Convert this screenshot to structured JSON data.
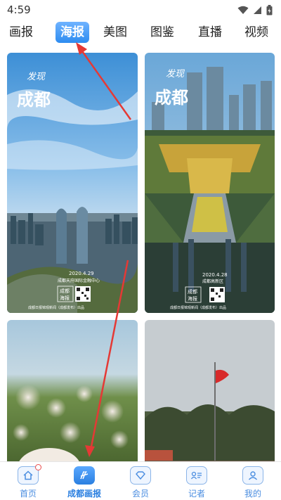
{
  "status_bar": {
    "time": "4:59",
    "icons": [
      "wifi-icon",
      "signal-icon",
      "battery-icon"
    ]
  },
  "tabs": [
    {
      "label": "画报",
      "active": false
    },
    {
      "label": "海报",
      "active": true
    },
    {
      "label": "美图",
      "active": false
    },
    {
      "label": "图鉴",
      "active": false
    },
    {
      "label": "直播",
      "active": false
    },
    {
      "label": "视频",
      "active": false
    }
  ],
  "posters": [
    {
      "title_small": "发现",
      "title_big": "成都",
      "date": "2020.4.29",
      "caption": "成都天府国际金融中心",
      "logo_line1": "成都",
      "logo_line2": "海报",
      "credit": "成都日报锦观新闻（成都发布）出品"
    },
    {
      "title_small": "发现",
      "title_big": "成都",
      "date": "2020.4.28",
      "caption": "成都高新区",
      "logo_line1": "成都",
      "logo_line2": "海报",
      "credit": "成都日报锦观新闻（成都发布）出品"
    }
  ],
  "bottom_nav": [
    {
      "label": "首页",
      "icon": "home-icon",
      "active": false
    },
    {
      "label": "成都画报",
      "icon": "pictorial-icon",
      "active": true
    },
    {
      "label": "会员",
      "icon": "member-icon",
      "active": false
    },
    {
      "label": "记者",
      "icon": "reporter-icon",
      "active": false
    },
    {
      "label": "我的",
      "icon": "profile-icon",
      "active": false
    }
  ],
  "colors": {
    "accent": "#2d8cf0",
    "arrow": "#e53935",
    "nav_text": "#4a8de0"
  }
}
